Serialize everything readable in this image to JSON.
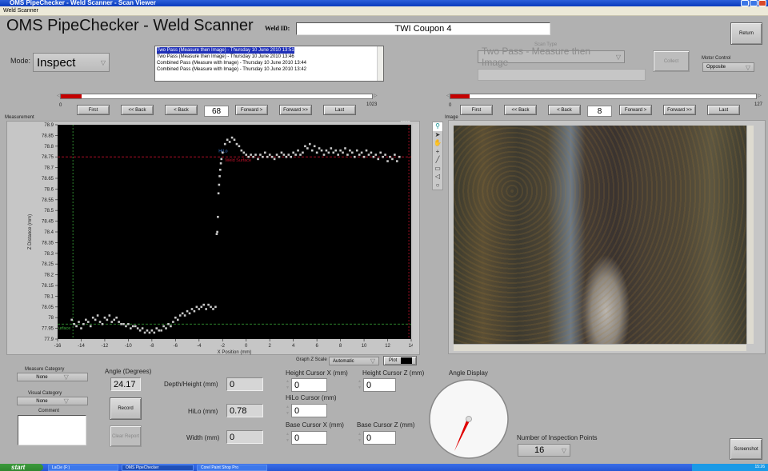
{
  "window": {
    "title": "OMS PipeChecker - Weld Scanner - Scan Viewer",
    "menu": "Weld Scanner"
  },
  "header": {
    "app_title": "OMS PipeChecker - Weld Scanner",
    "weld_id_label": "Weld ID:",
    "weld_id_value": "TWI Coupon 4",
    "return_label": "Return"
  },
  "mode": {
    "label": "Mode:",
    "value": "Inspect"
  },
  "scan_list": {
    "items": [
      {
        "text": "Two Pass (Measure then Image) - Thursday 10 June 2010 13:51",
        "selected": true
      },
      {
        "text": "Two Pass (Measure then Image) - Thursday 10 June 2010 13:46",
        "selected": false
      },
      {
        "text": "Combined Pass (Measure with Image) - Thursday 10 June 2010 13:44",
        "selected": false
      },
      {
        "text": "Combined Pass (Measure with Image) - Thursday 10 June 2010 13:42",
        "selected": false
      }
    ]
  },
  "scan_type": {
    "label": "Scan Type",
    "value": "Two Pass - Measure then Image",
    "status": "",
    "collect_label": "Collect"
  },
  "motor_control": {
    "label": "Motor Control",
    "value": "Opposite"
  },
  "measurement_nav": {
    "min": "0",
    "max": "1023",
    "current": "68",
    "position_fraction": 0.066,
    "buttons": [
      "First",
      "<< Back",
      "< Back",
      "Forward >",
      "Forward >>",
      "Last"
    ]
  },
  "image_nav": {
    "min": "0",
    "max": "127",
    "current": "8",
    "position_fraction": 0.063,
    "buttons": [
      "First",
      "<< Back",
      "< Back",
      "Forward >",
      "Forward >>",
      "Last"
    ]
  },
  "measurement_panel": {
    "label": "Measurement",
    "graph_z_scale_label": "Graph Z Scale",
    "graph_z_scale_value": "Automatic",
    "plot_label": "Plot"
  },
  "image_panel": {
    "label": "Image",
    "tools": [
      "zoom-icon",
      "pointer-icon",
      "pan-icon",
      "crosshair-icon",
      "line-icon",
      "rectangle-icon",
      "polygon-icon",
      "oval-icon"
    ]
  },
  "chart_data": {
    "type": "scatter",
    "title": "",
    "xlabel": "X Position (mm)",
    "ylabel": "Z Distance (mm)",
    "xlim": [
      -16,
      14
    ],
    "ylim": [
      77.9,
      78.9
    ],
    "xticks": [
      "-16",
      "-14",
      "-12",
      "-10",
      "-8",
      "-6",
      "-4",
      "-2",
      "0",
      "2",
      "4",
      "6",
      "8",
      "10",
      "12",
      "14"
    ],
    "yticks": [
      "78.9",
      "78.85",
      "78.8",
      "78.75",
      "78.7",
      "78.65",
      "78.6",
      "78.55",
      "78.5",
      "78.45",
      "78.4",
      "78.35",
      "78.3",
      "78.25",
      "78.2",
      "78.15",
      "78.1",
      "78.05",
      "78",
      "77.95",
      "77.9"
    ],
    "grid": false,
    "background": "#000000",
    "point_color": "#c8c8c8",
    "cursors": [
      {
        "name": "Weld Surface",
        "axis": "y",
        "value": 78.75,
        "color": "#c0102a"
      },
      {
        "name": "Base Surface",
        "axis": "y",
        "value": 77.97,
        "color": "#3aa83a"
      },
      {
        "name": "Base Cursor X",
        "axis": "x",
        "value": -14.7,
        "color": "#3aa83a"
      },
      {
        "name": "Height Cursor X",
        "axis": "x",
        "value": 13.8,
        "color": "#c0102a"
      },
      {
        "name": "HiLo",
        "axis": "point",
        "x": -2.0,
        "y": 78.76,
        "color": "#3b7bd6"
      }
    ],
    "series": [
      {
        "name": "profile",
        "x": [
          -14.8,
          -14.6,
          -14.4,
          -14.2,
          -14.0,
          -13.8,
          -13.6,
          -13.4,
          -13.2,
          -13.0,
          -12.8,
          -12.6,
          -12.4,
          -12.2,
          -12.0,
          -11.8,
          -11.6,
          -11.4,
          -11.2,
          -11.0,
          -10.8,
          -10.6,
          -10.4,
          -10.2,
          -10.0,
          -9.8,
          -9.6,
          -9.4,
          -9.2,
          -9.0,
          -8.8,
          -8.6,
          -8.4,
          -8.2,
          -8.0,
          -7.8,
          -7.6,
          -7.4,
          -7.2,
          -7.0,
          -6.8,
          -6.6,
          -6.4,
          -6.2,
          -6.0,
          -5.8,
          -5.6,
          -5.4,
          -5.2,
          -5.0,
          -4.8,
          -4.6,
          -4.4,
          -4.2,
          -4.0,
          -3.8,
          -3.6,
          -3.4,
          -3.2,
          -3.0,
          -2.8,
          -2.6,
          -2.5,
          -2.45,
          -2.4,
          -2.35,
          -2.3,
          -2.25,
          -2.2,
          -2.15,
          -2.1,
          -2.0,
          -1.8,
          -1.6,
          -1.4,
          -1.2,
          -1.0,
          -0.8,
          -0.6,
          -0.4,
          -0.2,
          0.0,
          0.2,
          0.4,
          0.6,
          0.8,
          1.0,
          1.2,
          1.4,
          1.6,
          1.8,
          2.0,
          2.2,
          2.4,
          2.6,
          2.8,
          3.0,
          3.2,
          3.4,
          3.6,
          3.8,
          4.0,
          4.2,
          4.4,
          4.6,
          4.8,
          5.0,
          5.2,
          5.4,
          5.6,
          5.8,
          6.0,
          6.2,
          6.4,
          6.6,
          6.8,
          7.0,
          7.2,
          7.4,
          7.6,
          7.8,
          8.0,
          8.2,
          8.4,
          8.6,
          8.8,
          9.0,
          9.2,
          9.4,
          9.6,
          9.8,
          10.0,
          10.2,
          10.4,
          10.6,
          10.8,
          11.0,
          11.2,
          11.4,
          11.6,
          11.8,
          12.0,
          12.2,
          12.4,
          12.6,
          12.8,
          13.0,
          13.2,
          13.4,
          13.6,
          13.8
        ],
        "y": [
          77.99,
          77.97,
          77.96,
          77.98,
          77.95,
          77.97,
          77.99,
          77.98,
          77.96,
          78.0,
          77.99,
          78.01,
          77.98,
          77.97,
          78.0,
          77.99,
          78.01,
          77.98,
          77.99,
          78.0,
          77.98,
          77.97,
          77.97,
          77.96,
          77.97,
          77.95,
          77.96,
          77.96,
          77.95,
          77.94,
          77.95,
          77.93,
          77.94,
          77.93,
          77.94,
          77.93,
          77.95,
          77.94,
          77.94,
          77.96,
          77.95,
          77.97,
          77.96,
          77.98,
          78.0,
          77.99,
          78.01,
          78.02,
          78.01,
          78.03,
          78.02,
          78.04,
          78.03,
          78.05,
          78.04,
          78.05,
          78.06,
          78.04,
          78.06,
          78.05,
          78.04,
          78.05,
          78.39,
          78.4,
          78.47,
          78.58,
          78.62,
          78.66,
          78.69,
          78.72,
          78.74,
          78.77,
          78.81,
          78.83,
          78.82,
          78.84,
          78.83,
          78.81,
          78.8,
          78.78,
          78.77,
          78.76,
          78.75,
          78.76,
          78.75,
          78.76,
          78.74,
          78.76,
          78.75,
          78.77,
          78.75,
          78.76,
          78.75,
          78.74,
          78.76,
          78.75,
          78.77,
          78.76,
          78.75,
          78.76,
          78.75,
          78.77,
          78.76,
          78.78,
          78.76,
          78.77,
          78.8,
          78.79,
          78.81,
          78.78,
          78.8,
          78.77,
          78.79,
          78.78,
          78.76,
          78.78,
          78.77,
          78.79,
          78.77,
          78.78,
          78.76,
          78.78,
          78.77,
          78.79,
          78.76,
          78.78,
          78.77,
          78.75,
          78.78,
          78.76,
          78.77,
          78.75,
          78.78,
          78.76,
          78.77,
          78.75,
          78.76,
          78.74,
          78.77,
          78.75,
          78.76,
          78.73,
          78.75,
          78.74,
          78.76,
          78.73,
          78.75
        ]
      }
    ]
  },
  "bottom_left": {
    "measure_category_label": "Measure Category",
    "measure_category_value": "None",
    "visual_category_label": "Visual Category",
    "visual_category_value": "None",
    "comment_label": "Comment",
    "comment_value": ""
  },
  "angle": {
    "label": "Angle (Degrees)",
    "value": "24.17",
    "display_label": "Angle Display",
    "degrees": 24.17
  },
  "actions": {
    "record": "Record",
    "clear_report": "Clear Report",
    "screenshot": "Screenshot"
  },
  "readouts": {
    "depth_height_label": "Depth/Height (mm)",
    "depth_height_value": "0",
    "hilo_label": "HiLo (mm)",
    "hilo_value": "0.78",
    "width_label": "Width (mm)",
    "width_value": "0"
  },
  "cursors": {
    "height_x_label": "Height Cursor X (mm)",
    "height_x_value": "0",
    "height_z_label": "Height Cursor Z (mm)",
    "height_z_value": "0",
    "hilo_label": "HiLo Cursor (mm)",
    "hilo_value": "0",
    "base_x_label": "Base Cursor X (mm)",
    "base_x_value": "0",
    "base_z_label": "Base Cursor Z (mm)",
    "base_z_value": "0"
  },
  "inspection_points": {
    "label": "Number of Inspection Points",
    "value": "16"
  },
  "taskbar": {
    "start": "start",
    "tasks": [
      "LaCie (F:)",
      "OMS PipeChecker",
      "Corel Paint Shop Pro"
    ],
    "clock": "15:26"
  }
}
